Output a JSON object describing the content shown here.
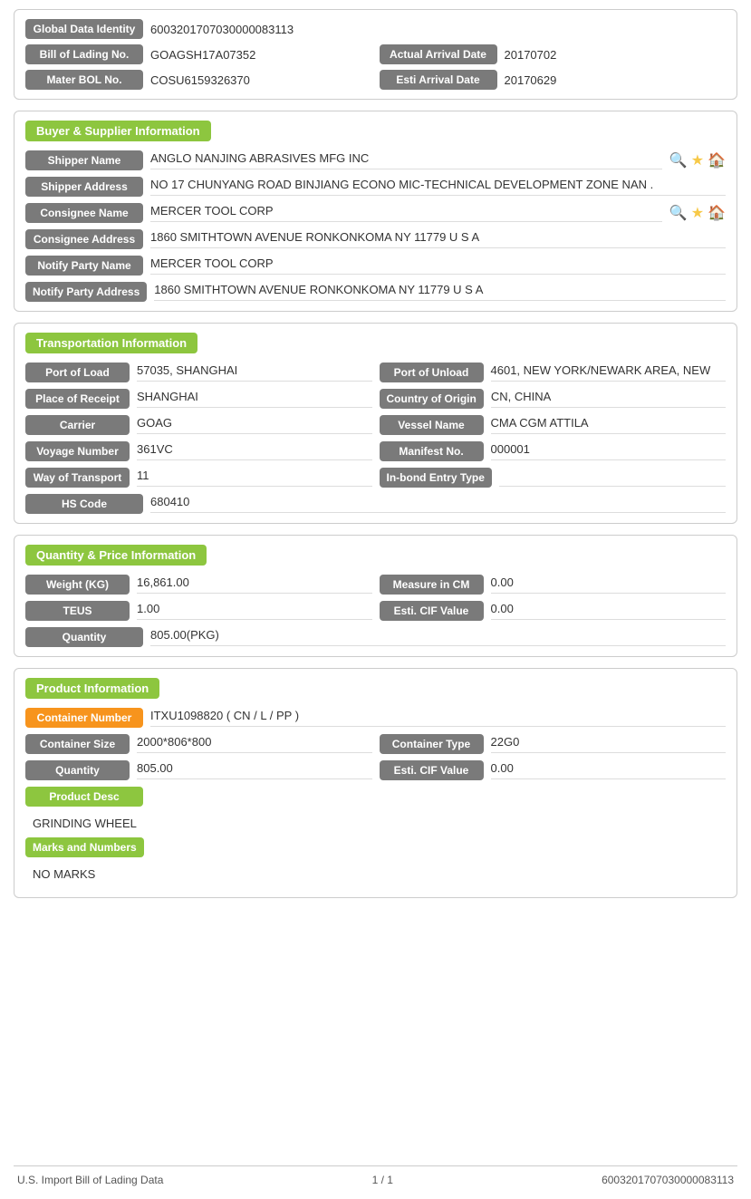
{
  "identity": {
    "global_data_label": "Global Data Identity",
    "global_data_value": "6003201707030000083113",
    "bol_label": "Bill of Lading No.",
    "bol_value": "GOAGSH17A07352",
    "actual_arrival_label": "Actual Arrival Date",
    "actual_arrival_value": "20170702",
    "master_bol_label": "Mater BOL No.",
    "master_bol_value": "COSU6159326370",
    "esti_arrival_label": "Esti Arrival Date",
    "esti_arrival_value": "20170629"
  },
  "buyer_supplier": {
    "section_title": "Buyer & Supplier Information",
    "shipper_name_label": "Shipper Name",
    "shipper_name_value": "ANGLO NANJING ABRASIVES MFG INC",
    "shipper_address_label": "Shipper Address",
    "shipper_address_value": "NO 17 CHUNYANG ROAD BINJIANG ECONO MIC-TECHNICAL DEVELOPMENT ZONE NAN .",
    "consignee_name_label": "Consignee Name",
    "consignee_name_value": "MERCER TOOL CORP",
    "consignee_address_label": "Consignee Address",
    "consignee_address_value": "1860 SMITHTOWN AVENUE RONKONKOMA NY 11779 U S A",
    "notify_party_name_label": "Notify Party Name",
    "notify_party_name_value": "MERCER TOOL CORP",
    "notify_party_address_label": "Notify Party Address",
    "notify_party_address_value": "1860 SMITHTOWN AVENUE RONKONKOMA NY 11779 U S A"
  },
  "transportation": {
    "section_title": "Transportation Information",
    "port_of_load_label": "Port of Load",
    "port_of_load_value": "57035, SHANGHAI",
    "port_of_unload_label": "Port of Unload",
    "port_of_unload_value": "4601, NEW YORK/NEWARK AREA, NEW",
    "place_of_receipt_label": "Place of Receipt",
    "place_of_receipt_value": "SHANGHAI",
    "country_of_origin_label": "Country of Origin",
    "country_of_origin_value": "CN, CHINA",
    "carrier_label": "Carrier",
    "carrier_value": "GOAG",
    "vessel_name_label": "Vessel Name",
    "vessel_name_value": "CMA CGM ATTILA",
    "voyage_number_label": "Voyage Number",
    "voyage_number_value": "361VC",
    "manifest_no_label": "Manifest No.",
    "manifest_no_value": "000001",
    "way_of_transport_label": "Way of Transport",
    "way_of_transport_value": "11",
    "in_bond_entry_label": "In-bond Entry Type",
    "in_bond_entry_value": "",
    "hs_code_label": "HS Code",
    "hs_code_value": "680410"
  },
  "quantity_price": {
    "section_title": "Quantity & Price Information",
    "weight_kg_label": "Weight (KG)",
    "weight_kg_value": "16,861.00",
    "measure_in_cm_label": "Measure in CM",
    "measure_in_cm_value": "0.00",
    "teus_label": "TEUS",
    "teus_value": "1.00",
    "esti_cif_label": "Esti. CIF Value",
    "esti_cif_value": "0.00",
    "quantity_label": "Quantity",
    "quantity_value": "805.00(PKG)"
  },
  "product": {
    "section_title": "Product Information",
    "container_number_label": "Container Number",
    "container_number_value": "ITXU1098820 ( CN / L / PP )",
    "container_size_label": "Container Size",
    "container_size_value": "2000*806*800",
    "container_type_label": "Container Type",
    "container_type_value": "22G0",
    "quantity_label": "Quantity",
    "quantity_value": "805.00",
    "esti_cif_label": "Esti. CIF Value",
    "esti_cif_value": "0.00",
    "product_desc_label": "Product Desc",
    "product_desc_value": "GRINDING WHEEL",
    "marks_numbers_label": "Marks and Numbers",
    "marks_numbers_value": "NO MARKS"
  },
  "footer": {
    "left": "U.S. Import Bill of Lading Data",
    "center": "1 / 1",
    "right": "6003201707030000083113"
  }
}
